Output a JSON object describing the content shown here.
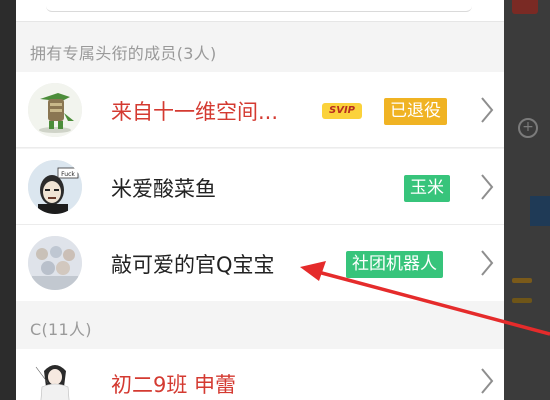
{
  "sections": [
    {
      "header": "拥有专属头衔的成员(3人)"
    },
    {
      "header": "C(11人)"
    }
  ],
  "members": [
    {
      "name": "来自十一维空间...",
      "svip": "SVIP",
      "title": "已退役"
    },
    {
      "name": "米爱酸菜鱼",
      "title": "玉米",
      "avatar_text": "Fuck"
    },
    {
      "name": "敲可爱的官Q宝宝",
      "title": "社团机器人"
    },
    {
      "name": "初二9班 申蕾"
    }
  ],
  "colors": {
    "accent_red": "#d43a31",
    "badge_orange": "#f0b323",
    "badge_green": "#37c47b",
    "annotation_arrow": "#e52b2b"
  },
  "icons": {
    "row_chevron": "chevron-right-icon",
    "background_zoom": "zoom-in-icon"
  }
}
